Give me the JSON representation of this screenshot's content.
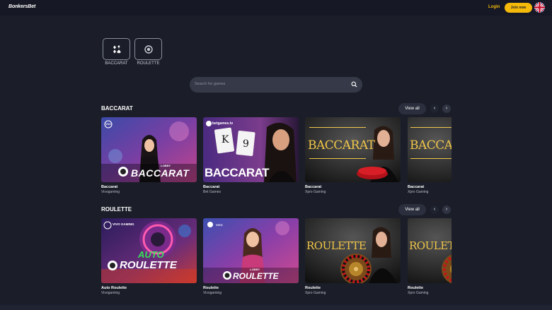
{
  "header": {
    "logo": "BonkersBet",
    "login_label": "Login",
    "join_label": "Join now",
    "language_icon": "uk-flag-icon"
  },
  "categories": [
    {
      "label": "BACCARAT",
      "icon": "cards-suits-icon"
    },
    {
      "label": "ROULETTE",
      "icon": "roulette-wheel-icon"
    }
  ],
  "search": {
    "placeholder": "Search for games",
    "icon": "search-icon"
  },
  "sections": [
    {
      "title": "BACCARAT",
      "view_all": "View all",
      "prev_icon": "chevron-left-icon",
      "next_icon": "chevron-right-icon",
      "games": [
        {
          "name": "Baccarat",
          "provider": "Vivogaming",
          "art_text": "BACCARAT",
          "art_badge": "LOBBY",
          "logo": "VIVO"
        },
        {
          "name": "Baccarat",
          "provider": "Bet Games",
          "art_text": "BACCARAT",
          "logo": "betgames.tv"
        },
        {
          "name": "Baccarat",
          "provider": "Xpro Gaming",
          "art_text": "BACCARAT"
        },
        {
          "name": "Baccarat",
          "provider": "Xpro Gaming",
          "art_text": "BACCARAT"
        }
      ]
    },
    {
      "title": "ROULETTE",
      "view_all": "View all",
      "prev_icon": "chevron-left-icon",
      "next_icon": "chevron-right-icon",
      "games": [
        {
          "name": "Auto Roulette",
          "provider": "Vivogaming",
          "art_text": "ROULETTE",
          "art_badge": "AUTO",
          "logo": "VIVO GAMING"
        },
        {
          "name": "Roulette",
          "provider": "Vivogaming",
          "art_text": "ROULETTE",
          "art_badge": "LOBBY",
          "logo": "VIVO"
        },
        {
          "name": "Roulette",
          "provider": "Xpro Gaming",
          "art_text": "ROULETTE"
        },
        {
          "name": "Roulette",
          "provider": "Xpro Gaming",
          "art_text": "ROULETTE"
        }
      ]
    }
  ],
  "colors": {
    "background": "#1b1e29",
    "header": "#161925",
    "accent": "#f5b90a",
    "search_bg": "#363a48",
    "gold_text": "#f0c64a"
  }
}
